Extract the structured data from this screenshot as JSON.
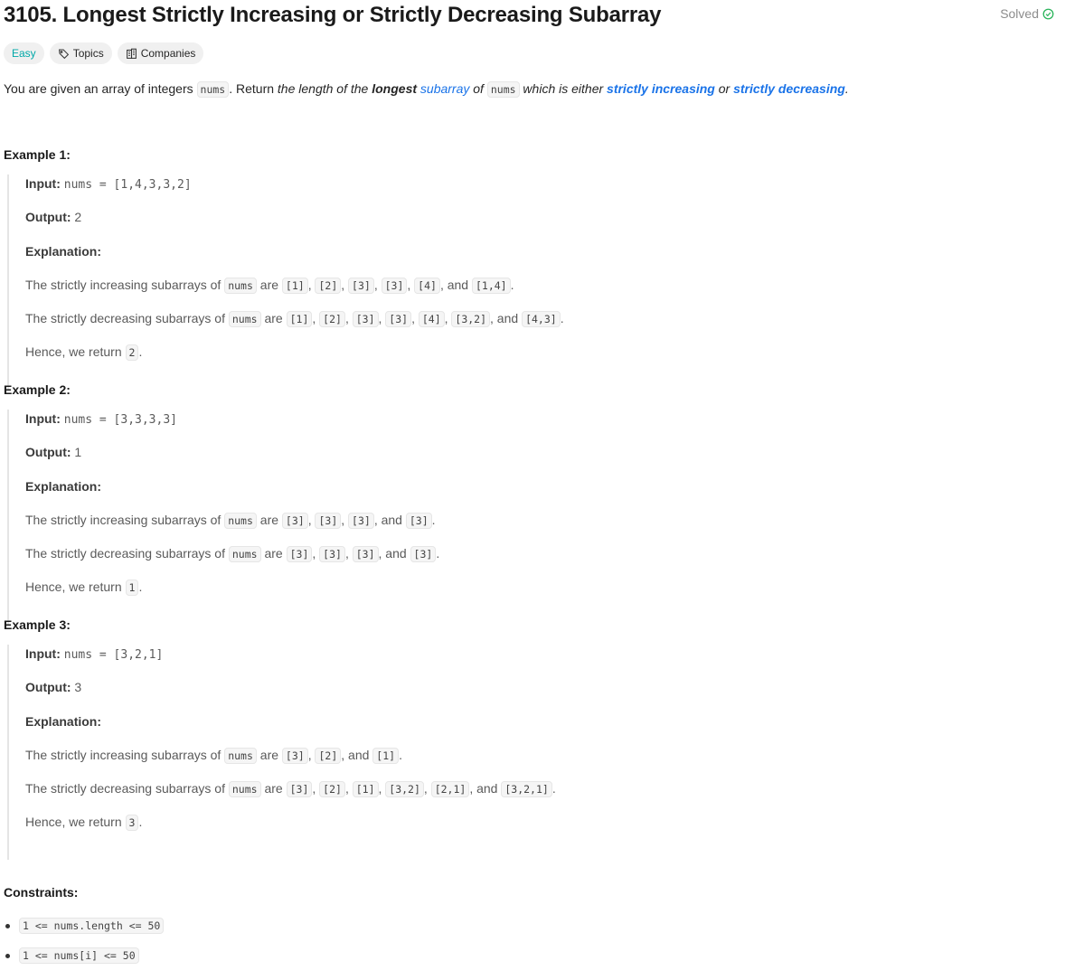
{
  "problem": {
    "title": "3105. Longest Strictly Increasing or Strictly Decreasing Subarray",
    "status": "Solved",
    "difficulty": "Easy",
    "topics_label": "Topics",
    "companies_label": "Companies"
  },
  "intro": {
    "t1": "You are given an array of integers ",
    "code_nums": "nums",
    "t2": ". Return ",
    "t3": "the length of the ",
    "longest": "longest",
    "subarray": "subarray",
    "t4": " of ",
    "t5": " which is either ",
    "strictly_increasing": "strictly increasing",
    "or": " or ",
    "strictly_decreasing": "strictly decreasing",
    "end": "."
  },
  "labels": {
    "input": "Input:",
    "output": "Output:",
    "explanation": "Explanation:",
    "inc_prefix": "The strictly increasing subarrays of ",
    "dec_prefix": "The strictly decreasing subarrays of ",
    "are": " are ",
    "comma": ", ",
    "and": ", and ",
    "period": ".",
    "hence": "Hence, we return ",
    "nums": "nums",
    "constraints": "Constraints:"
  },
  "examples": [
    {
      "heading": "Example 1:",
      "input": "nums = [1,4,3,3,2]",
      "output": "2",
      "increasing": [
        "[1]",
        "[2]",
        "[3]",
        "[3]",
        "[4]",
        "[1,4]"
      ],
      "decreasing": [
        "[1]",
        "[2]",
        "[3]",
        "[3]",
        "[4]",
        "[3,2]",
        "[4,3]"
      ],
      "return": "2"
    },
    {
      "heading": "Example 2:",
      "input": "nums = [3,3,3,3]",
      "output": "1",
      "increasing": [
        "[3]",
        "[3]",
        "[3]",
        "[3]"
      ],
      "decreasing": [
        "[3]",
        "[3]",
        "[3]",
        "[3]"
      ],
      "return": "1"
    },
    {
      "heading": "Example 3:",
      "input": "nums = [3,2,1]",
      "output": "3",
      "increasing": [
        "[3]",
        "[2]",
        "[1]"
      ],
      "decreasing": [
        "[3]",
        "[2]",
        "[1]",
        "[3,2]",
        "[2,1]",
        "[3,2,1]"
      ],
      "return": "3"
    }
  ],
  "constraints": [
    "1 <= nums.length <= 50",
    "1 <= nums[i] <= 50"
  ],
  "colors": {
    "accent": "#1a73e8",
    "easy": "#00a8a8",
    "solved_icon": "#2db55d"
  }
}
